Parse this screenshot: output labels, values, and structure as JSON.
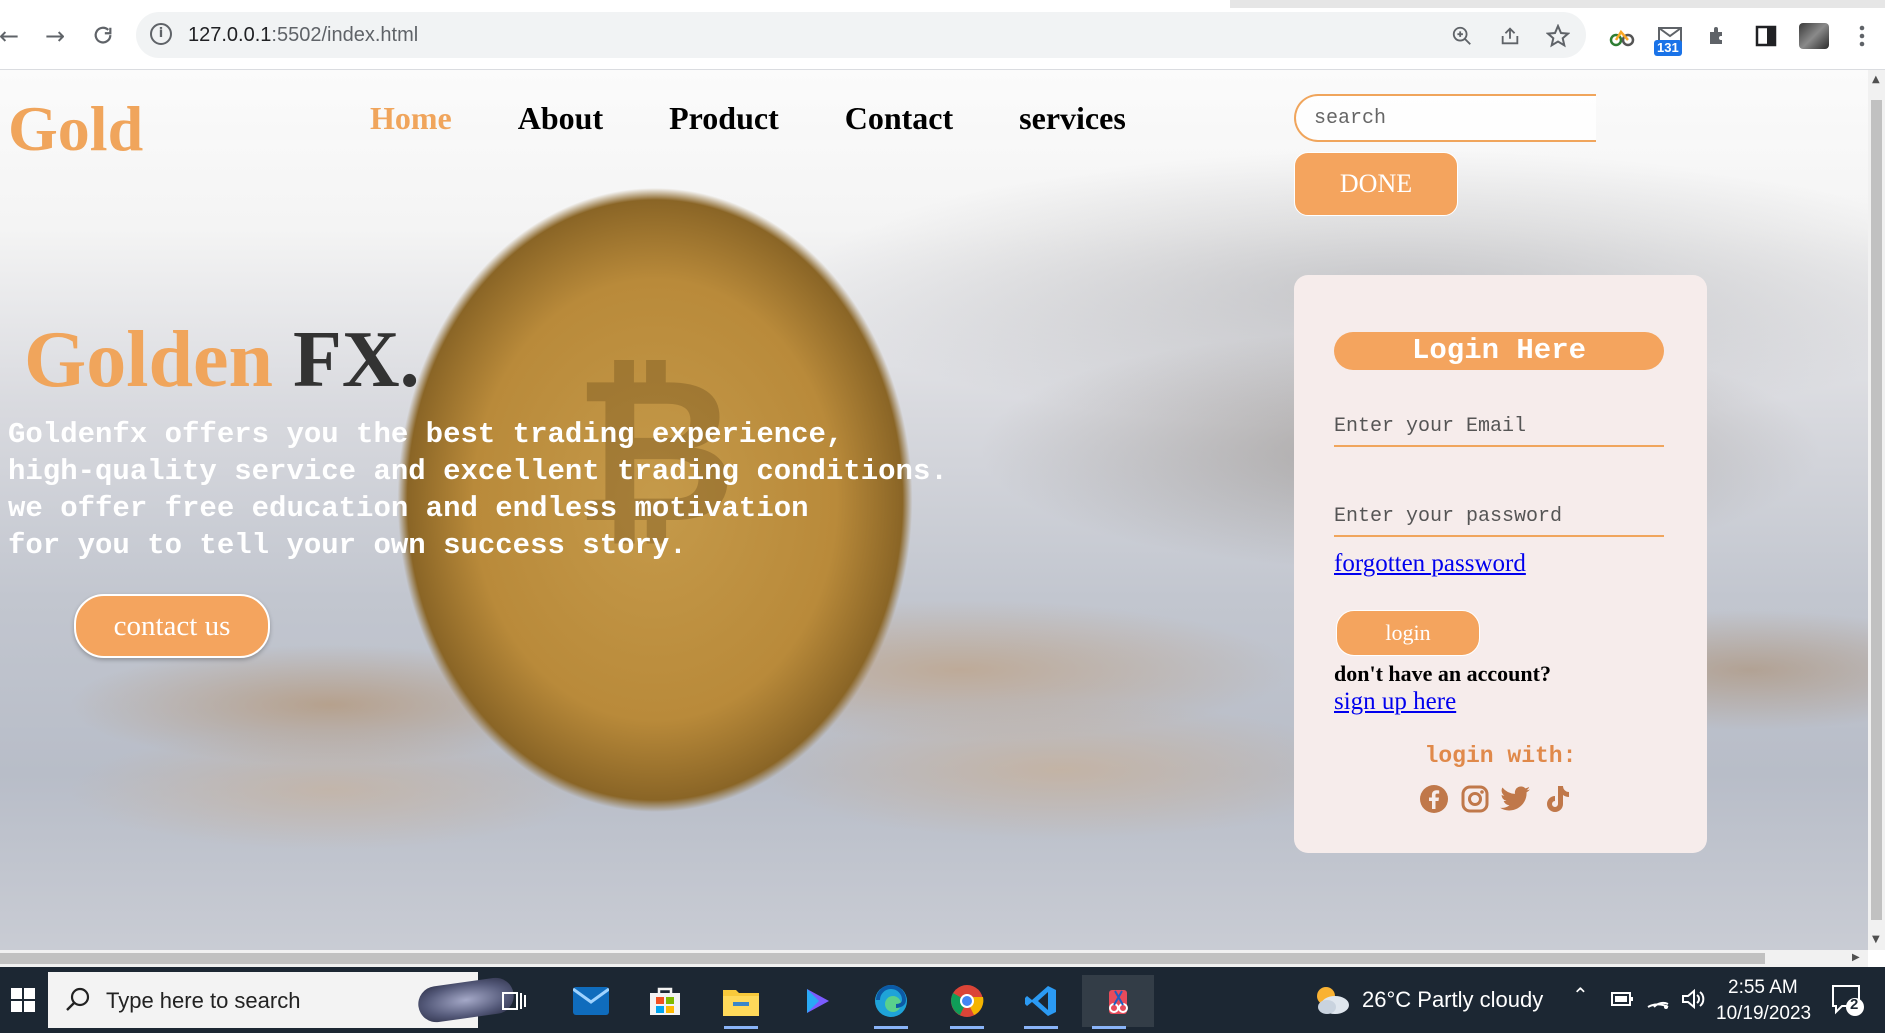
{
  "browser": {
    "url_host": "127.0.0.1",
    "url_rest": ":5502/index.html",
    "extension_badge": "131"
  },
  "site": {
    "logo": "Gold",
    "nav": [
      "Home",
      "About",
      "Product",
      "Contact",
      "services"
    ],
    "active_nav": "Home",
    "search_placeholder": "search",
    "done_label": "DONE",
    "hero_title_gold": "Golden",
    "hero_title_dark": "FX.",
    "hero_lines": [
      "Goldenfx offers you the best trading experience,",
      "high-quality service and excellent trading conditions.",
      "we offer free education and endless motivation",
      "for you to tell your own success story."
    ],
    "contact_label": "contact us",
    "accent_color": "#f4a45e"
  },
  "login": {
    "heading": "Login Here",
    "email_placeholder": "Enter your Email",
    "password_placeholder": "Enter your password",
    "forgot_label": "forgotten password",
    "login_label": "login",
    "no_account": "don't have an account?",
    "signup_label": "sign up here",
    "login_with": "login with:",
    "socials": [
      "facebook-icon",
      "instagram-icon",
      "twitter-icon",
      "tiktok-icon"
    ]
  },
  "taskbar": {
    "search_placeholder": "Type here to search",
    "weather": "26°C  Partly cloudy",
    "time": "2:55 AM",
    "date": "10/19/2023",
    "notifications": "2"
  }
}
